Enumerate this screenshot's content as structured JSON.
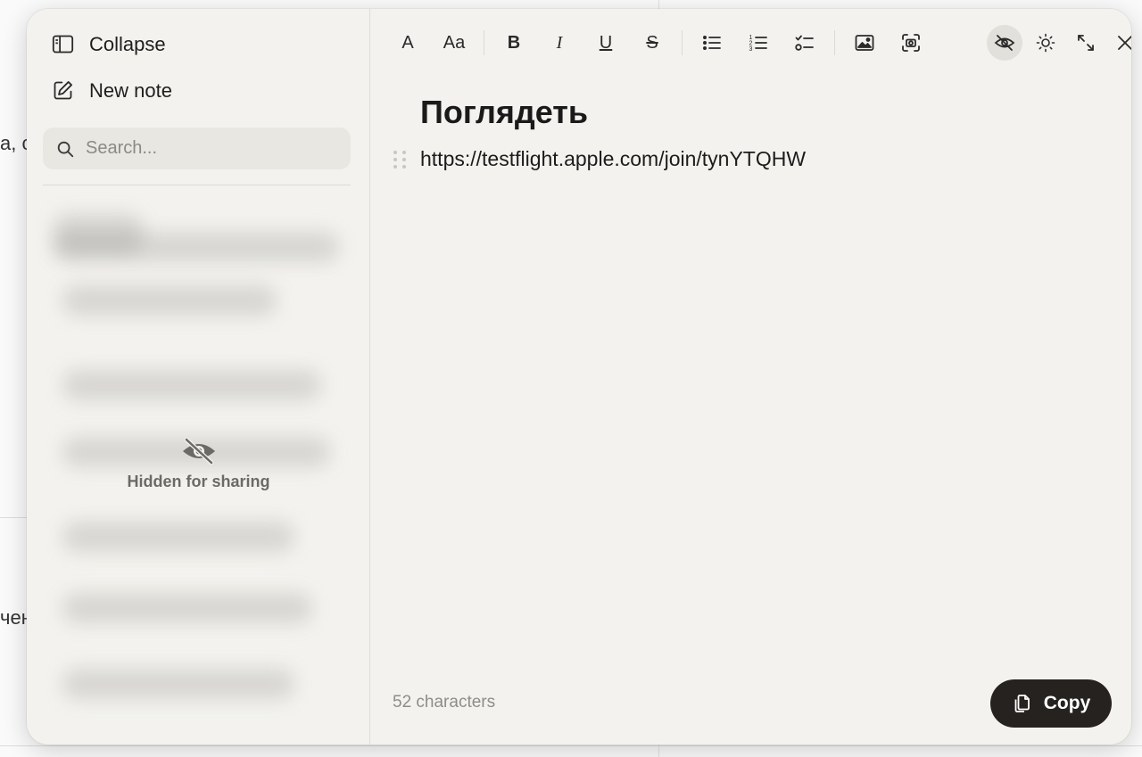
{
  "background": {
    "fragment_top": "а, с",
    "fragment_bottom": "чен"
  },
  "sidebar": {
    "collapse_label": "Collapse",
    "new_note_label": "New note",
    "search_placeholder": "Search...",
    "hidden_label": "Hidden for sharing"
  },
  "toolbar": {
    "font_button": "A",
    "font_size_button": "Aa",
    "bold_button": "B",
    "italic_button": "I",
    "underline_button": "U",
    "strike_button": "S",
    "privacy_active": true
  },
  "note": {
    "title": "Поглядеть",
    "body": "https://testflight.apple.com/join/tynYTQHW",
    "char_count": "52 characters"
  },
  "copy_button": {
    "label": "Copy"
  },
  "colors": {
    "window_bg": "#f3f2ee",
    "copy_button_bg": "#25221f",
    "muted_text": "#8f8d88"
  }
}
